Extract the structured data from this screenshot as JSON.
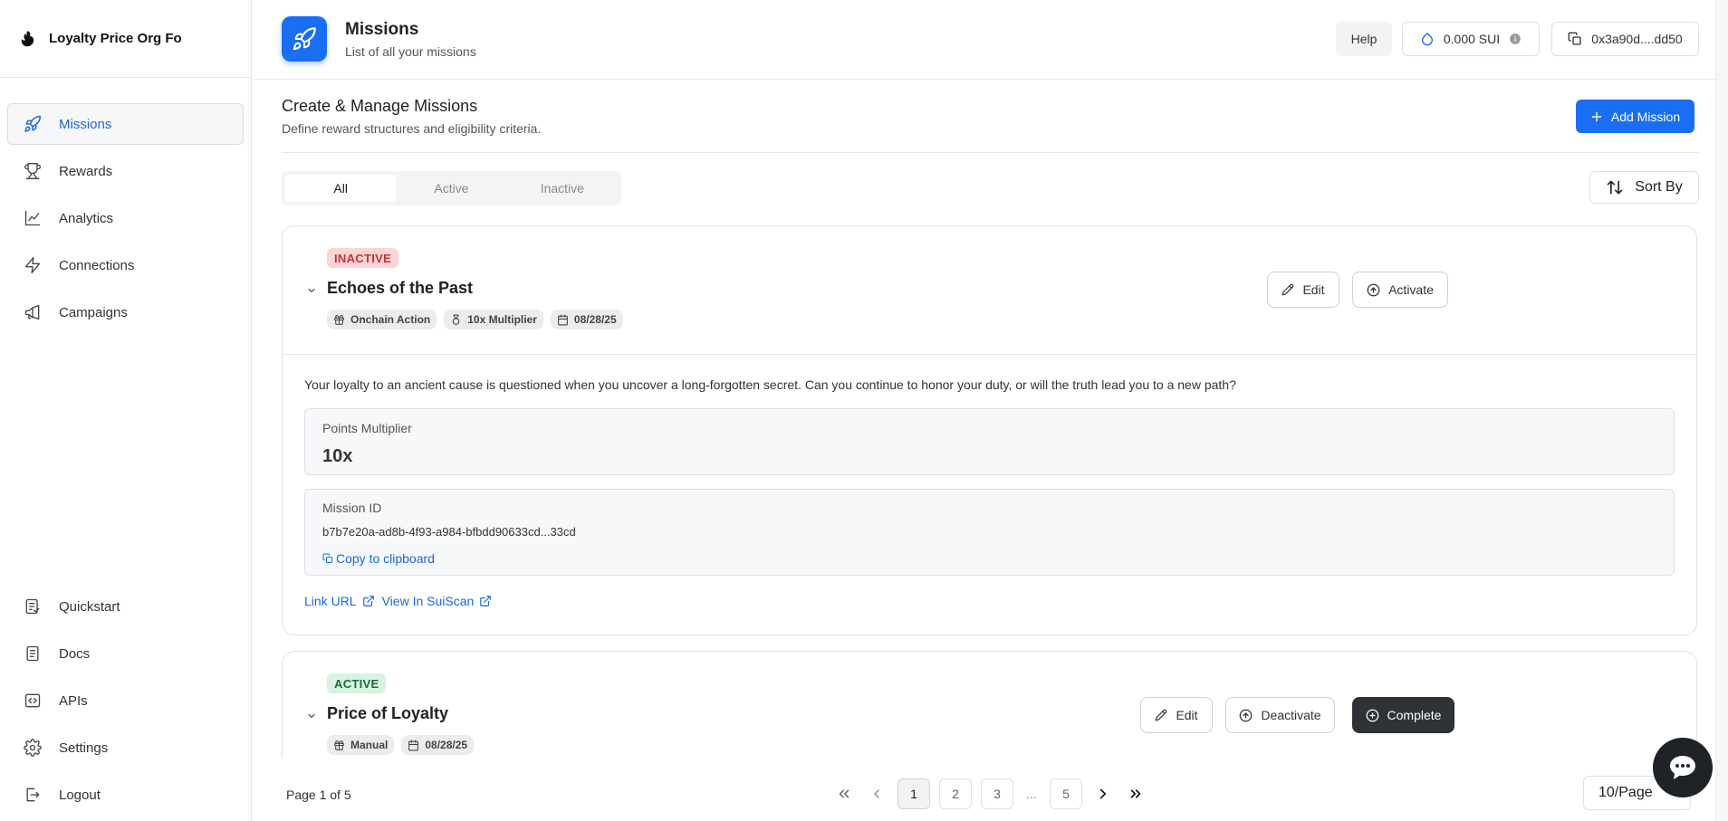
{
  "brand": {
    "name": "Loyalty Price Org Fo"
  },
  "sidebar": {
    "items": [
      {
        "label": "Missions",
        "icon": "rocket-icon",
        "active": true
      },
      {
        "label": "Rewards",
        "icon": "trophy-icon"
      },
      {
        "label": "Analytics",
        "icon": "chart-line-icon"
      },
      {
        "label": "Connections",
        "icon": "lightning-icon"
      },
      {
        "label": "Campaigns",
        "icon": "megaphone-icon"
      }
    ],
    "bottom_items": [
      {
        "label": "Quickstart",
        "icon": "checklist-icon"
      },
      {
        "label": "Docs",
        "icon": "document-icon"
      },
      {
        "label": "APIs",
        "icon": "code-icon"
      },
      {
        "label": "Settings",
        "icon": "gear-icon"
      },
      {
        "label": "Logout",
        "icon": "logout-icon"
      }
    ]
  },
  "header": {
    "title": "Missions",
    "subtitle": "List of all your missions",
    "help_label": "Help",
    "balance": "0.000 SUI",
    "address": "0x3a90d....dd50"
  },
  "main": {
    "title": "Create & Manage Missions",
    "subtitle": "Define reward structures and eligibility criteria.",
    "add_label": "Add Mission",
    "tabs": [
      {
        "label": "All",
        "active": true
      },
      {
        "label": "Active"
      },
      {
        "label": "Inactive"
      }
    ],
    "sort_label": "Sort By"
  },
  "missions": [
    {
      "status": "INACTIVE",
      "title": "Echoes of the Past",
      "tags": [
        "Onchain Action",
        "10x Multiplier",
        "08/28/25"
      ],
      "edit_label": "Edit",
      "toggle_label": "Activate",
      "description": "Your loyalty to an ancient cause is questioned when you uncover a long-forgotten secret. Can you continue to honor your duty, or will the truth lead you to a new path?",
      "multiplier_label": "Points Multiplier",
      "multiplier_value": "10x",
      "id_label": "Mission ID",
      "id_value": "b7b7e20a-ad8b-4f93-a984-bfbdd90633cd...33cd",
      "copy_label": "Copy to clipboard",
      "link_url_label": "Link URL",
      "suiscan_label": "View In SuiScan"
    },
    {
      "status": "ACTIVE",
      "title": "Price of Loyalty",
      "tags": [
        "Manual",
        "08/28/25"
      ],
      "edit_label": "Edit",
      "toggle_label": "Deactivate",
      "complete_label": "Complete"
    }
  ],
  "pagination": {
    "info": "Page 1 of 5",
    "pages": [
      "1",
      "2",
      "3",
      "...",
      "5"
    ],
    "per_page": "10/Page"
  },
  "colors": {
    "accent": "#1a6ef5",
    "inactive_bg": "#fbd4d4",
    "active_bg": "#d8f3e3",
    "dark_button": "#2f3237"
  }
}
